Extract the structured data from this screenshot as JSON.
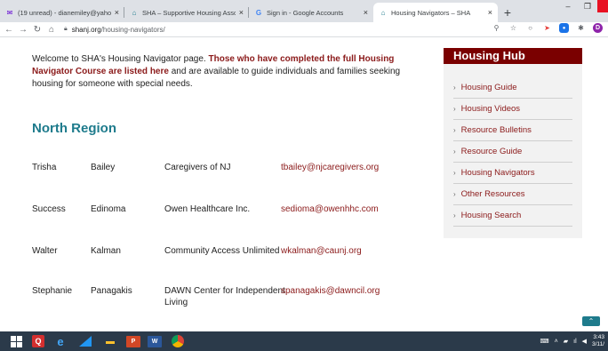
{
  "browser": {
    "tabs": [
      {
        "title": "(19 unread) - dianemiley@yahoo",
        "icon": "mail-icon",
        "active": false
      },
      {
        "title": "SHA – Supportive Housing Assoc",
        "icon": "sha-logo-icon",
        "active": false
      },
      {
        "title": "Sign in - Google Accounts",
        "icon": "google-icon",
        "active": false
      },
      {
        "title": "Housing Navigators – SHA",
        "icon": "sha-logo-icon",
        "active": true
      }
    ],
    "close_glyph": "×",
    "new_tab_glyph": "+",
    "url_host": "shanj.org",
    "url_path": "/housing-navigators/"
  },
  "page": {
    "intro_part1": "Welcome to SHA's Housing Navigator page. ",
    "intro_highlight": "Those who have completed the full Housing Navigator Course are listed here",
    "intro_part2": " and are available to guide individuals and families seeking housing for someone with special needs.",
    "region_title": "North Region",
    "navigators": [
      {
        "first": "Trisha",
        "last": "Bailey",
        "org": "Caregivers of NJ",
        "email": "tbailey@njcaregivers.org"
      },
      {
        "first": "Success",
        "last": "Edinoma",
        "org": "Owen Healthcare Inc.",
        "email": "sedioma@owenhhc.com"
      },
      {
        "first": "Walter",
        "last": "Kalman",
        "org": "Community Access Unlimited",
        "email": "wkalman@caunj.org"
      },
      {
        "first": "Stephanie",
        "last": "Panagakis",
        "org": "DAWN Center for Independent Living",
        "email": "spanagakis@dawncil.org"
      }
    ]
  },
  "sidebar": {
    "title": "Housing Hub",
    "items": [
      "Housing Guide",
      "Housing Videos",
      "Resource Bulletins",
      "Resource Guide",
      "Housing Navigators",
      "Other Resources",
      "Housing Search"
    ]
  },
  "taskbar": {
    "q_label": "Q",
    "ppt_label": "P",
    "word_label": "W",
    "time": "3:43",
    "date": "3/11/"
  },
  "colors": {
    "accent_maroon": "#7a0000",
    "link_maroon": "#8b1a1a",
    "region_teal": "#1e7b8c"
  }
}
